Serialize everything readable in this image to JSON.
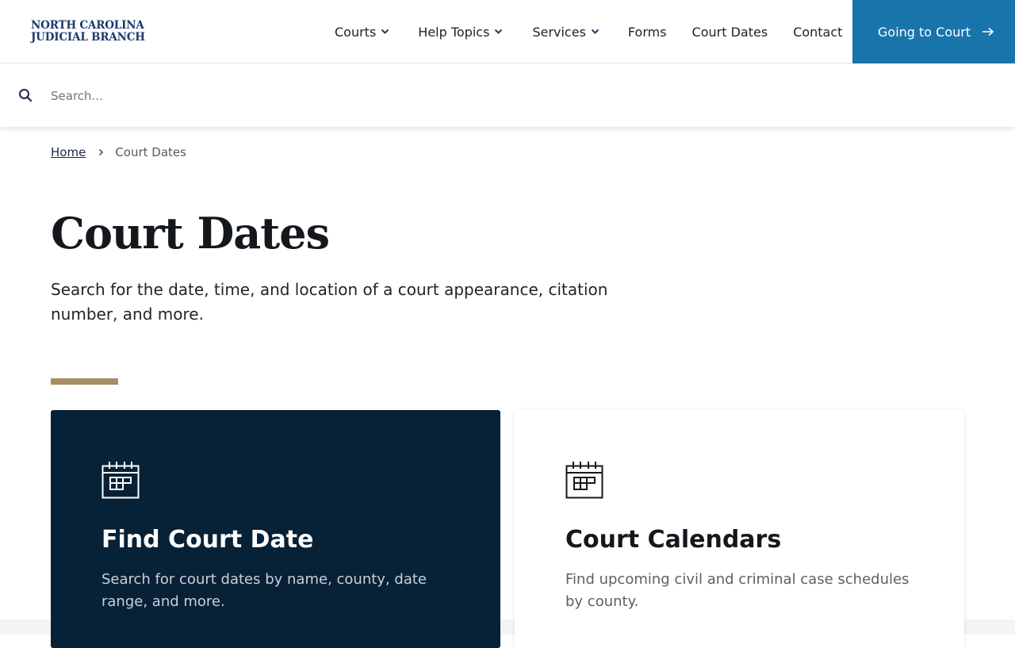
{
  "header": {
    "logo_line1": "NORTH CAROLINA",
    "logo_line2": "JUDICIAL BRANCH",
    "nav": [
      {
        "label": "Courts",
        "has_dropdown": true
      },
      {
        "label": "Help Topics",
        "has_dropdown": true
      },
      {
        "label": "Services",
        "has_dropdown": true
      },
      {
        "label": "Forms",
        "has_dropdown": false
      },
      {
        "label": "Court Dates",
        "has_dropdown": false
      },
      {
        "label": "Contact",
        "has_dropdown": false
      }
    ],
    "cta_label": "Going to Court",
    "cta_icon": "arrow-right-icon"
  },
  "search": {
    "placeholder": "Search...",
    "value": "",
    "icon": "search-icon"
  },
  "breadcrumb": {
    "home": "Home",
    "separator_icon": "chevron-right-icon",
    "current": "Court Dates"
  },
  "page": {
    "title": "Court Dates",
    "lead": "Search for the date, time, and location of a court appearance, citation number, and more."
  },
  "cards": [
    {
      "title": "Find Court Date",
      "description": "Search for court dates by name, county, date range, and more.",
      "icon": "calendar-icon",
      "theme": "dark"
    },
    {
      "title": "Court Calendars",
      "description": "Find upcoming civil and criminal case schedules by county.",
      "icon": "calendar-icon",
      "theme": "light"
    }
  ],
  "colors": {
    "brand_navy": "#1e3a6d",
    "cta_blue": "#1a74ac",
    "card_dark": "#072136",
    "accent_gold": "#a58e63"
  }
}
